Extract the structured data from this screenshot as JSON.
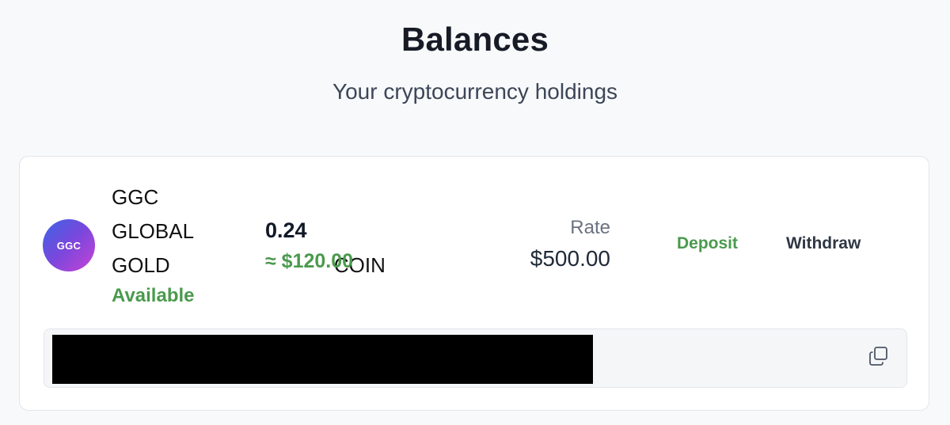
{
  "header": {
    "title": "Balances",
    "subtitle": "Your cryptocurrency holdings"
  },
  "balance": {
    "logo_text": "GGC",
    "name_lines": [
      "GGC",
      "GLOBAL",
      "GOLD COIN"
    ],
    "status": "Available",
    "amount": "0.24",
    "usd_value": "≈ $120.00",
    "rate_label": "Rate",
    "rate_value": "$500.00",
    "deposit_label": "Deposit",
    "withdraw_label": "Withdraw",
    "copy_icon": "copy-icon"
  },
  "colors": {
    "accent_green": "#4a9a4d",
    "logo_gradient": [
      "#3b64e6",
      "#7b47dc",
      "#c843d6"
    ]
  }
}
